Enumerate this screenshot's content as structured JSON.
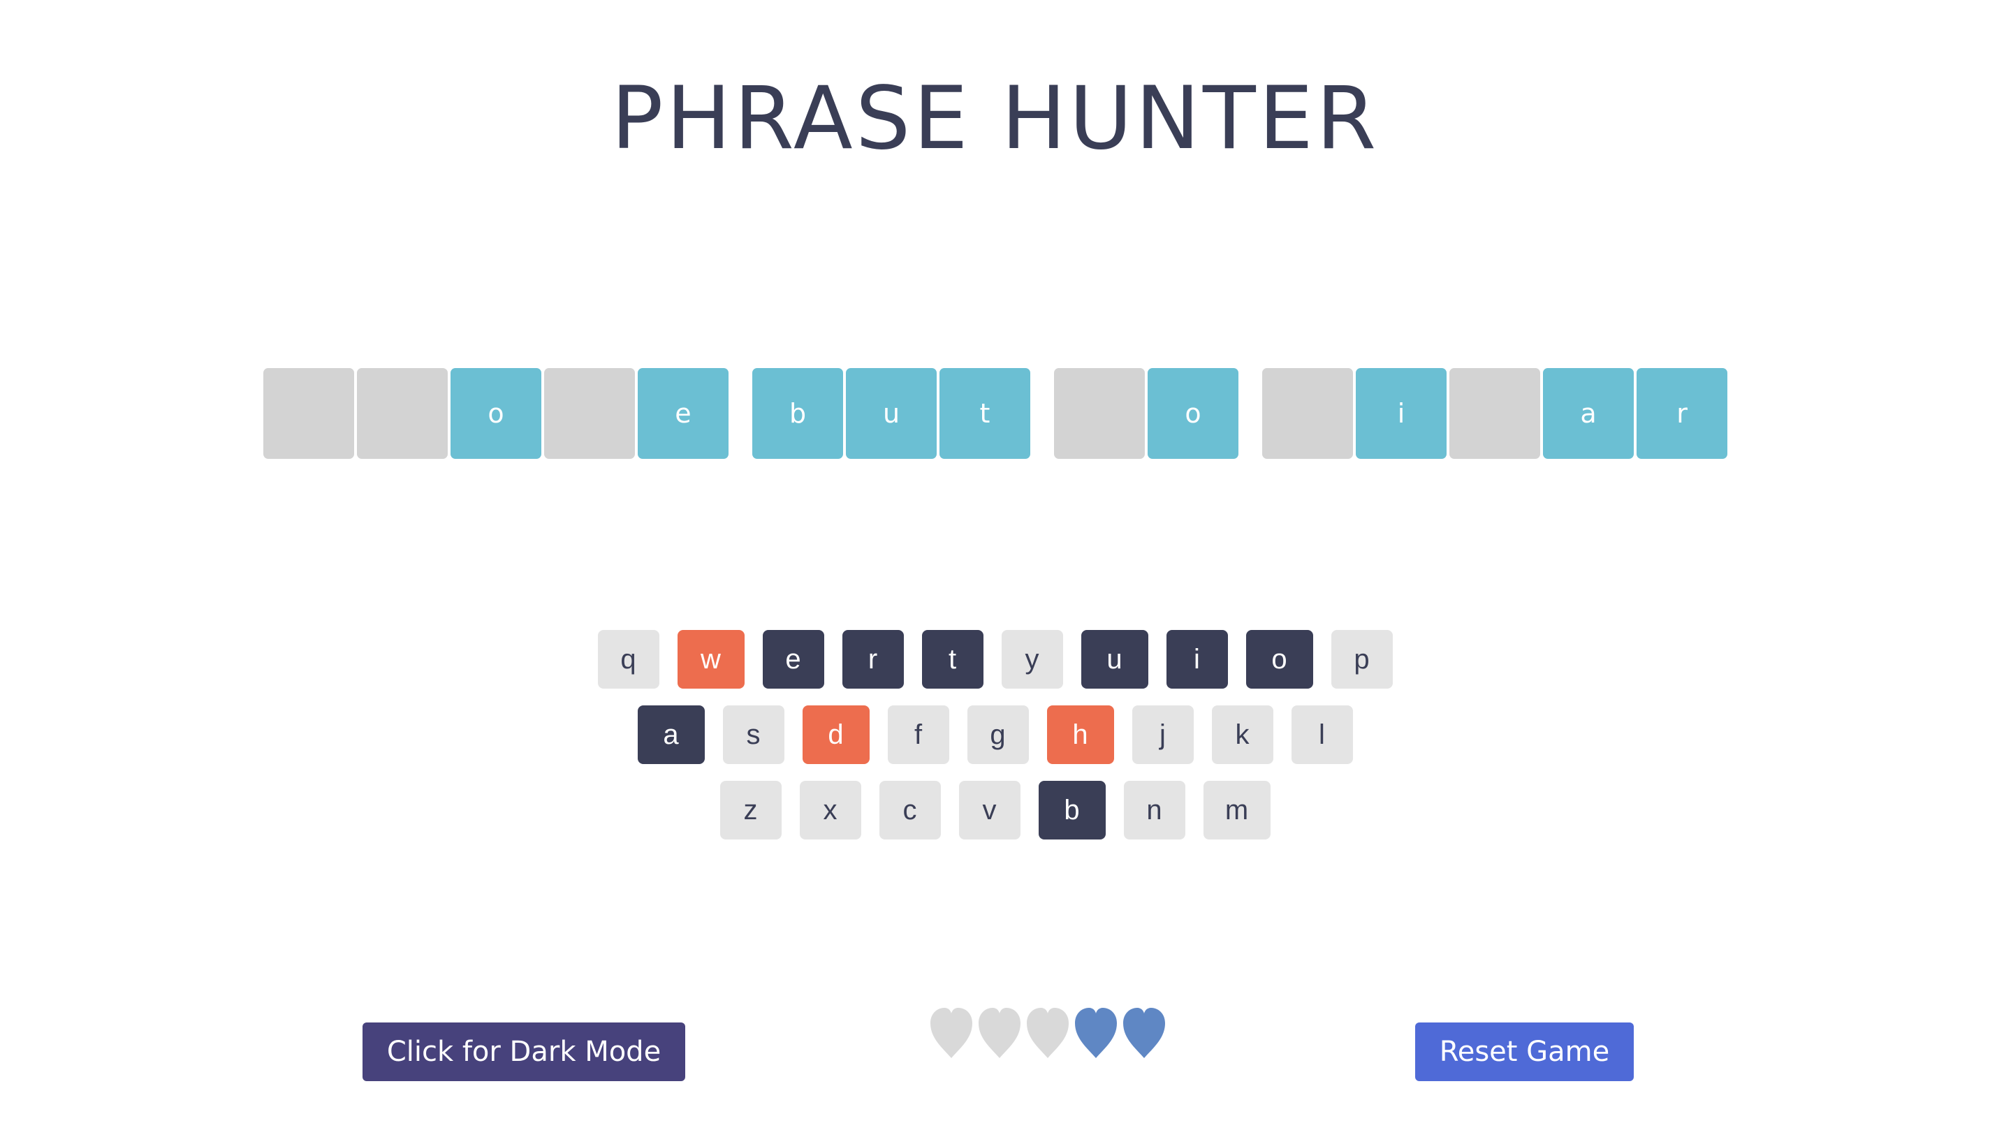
{
  "title": "PHRASE HUNTER",
  "phrase": {
    "words": [
      [
        {
          "letter": "",
          "shown": false
        },
        {
          "letter": "",
          "shown": false
        },
        {
          "letter": "o",
          "shown": true
        },
        {
          "letter": "",
          "shown": false
        },
        {
          "letter": "e",
          "shown": true
        }
      ],
      [
        {
          "letter": "b",
          "shown": true
        },
        {
          "letter": "u",
          "shown": true
        },
        {
          "letter": "t",
          "shown": true
        }
      ],
      [
        {
          "letter": "",
          "shown": false
        },
        {
          "letter": "o",
          "shown": true
        }
      ],
      [
        {
          "letter": "",
          "shown": false
        },
        {
          "letter": "i",
          "shown": true
        },
        {
          "letter": "",
          "shown": false
        },
        {
          "letter": "a",
          "shown": true
        },
        {
          "letter": "r",
          "shown": true
        }
      ]
    ]
  },
  "keyboard": {
    "rows": [
      [
        {
          "key": "q",
          "state": "unused"
        },
        {
          "key": "w",
          "state": "wrong"
        },
        {
          "key": "e",
          "state": "chosen"
        },
        {
          "key": "r",
          "state": "chosen"
        },
        {
          "key": "t",
          "state": "chosen"
        },
        {
          "key": "y",
          "state": "unused"
        },
        {
          "key": "u",
          "state": "chosen"
        },
        {
          "key": "i",
          "state": "chosen"
        },
        {
          "key": "o",
          "state": "chosen"
        },
        {
          "key": "p",
          "state": "unused"
        }
      ],
      [
        {
          "key": "a",
          "state": "chosen"
        },
        {
          "key": "s",
          "state": "unused"
        },
        {
          "key": "d",
          "state": "wrong"
        },
        {
          "key": "f",
          "state": "unused"
        },
        {
          "key": "g",
          "state": "unused"
        },
        {
          "key": "h",
          "state": "wrong"
        },
        {
          "key": "j",
          "state": "unused"
        },
        {
          "key": "k",
          "state": "unused"
        },
        {
          "key": "l",
          "state": "unused"
        }
      ],
      [
        {
          "key": "z",
          "state": "unused"
        },
        {
          "key": "x",
          "state": "unused"
        },
        {
          "key": "c",
          "state": "unused"
        },
        {
          "key": "v",
          "state": "unused"
        },
        {
          "key": "b",
          "state": "chosen"
        },
        {
          "key": "n",
          "state": "unused"
        },
        {
          "key": "m",
          "state": "unused"
        }
      ]
    ]
  },
  "lives": {
    "total": 5,
    "remaining": 2,
    "hearts": [
      "lost",
      "lost",
      "lost",
      "live",
      "live"
    ]
  },
  "buttons": {
    "dark_mode_label": "Click for Dark Mode",
    "reset_label": "Reset Game"
  },
  "colors": {
    "title_text": "#3a3e56",
    "tile_hidden": "#d3d3d3",
    "tile_shown": "#6bbfd3",
    "key_unused": "#e4e4e4",
    "key_chosen": "#3a3e56",
    "key_wrong": "#ed6d4e",
    "heart_live": "#5f87c4",
    "heart_lost": "#d9d9d9",
    "dark_mode_button": "#47427c",
    "reset_button": "#4f6ad7"
  },
  "icons": {
    "life": "heart-icon"
  }
}
